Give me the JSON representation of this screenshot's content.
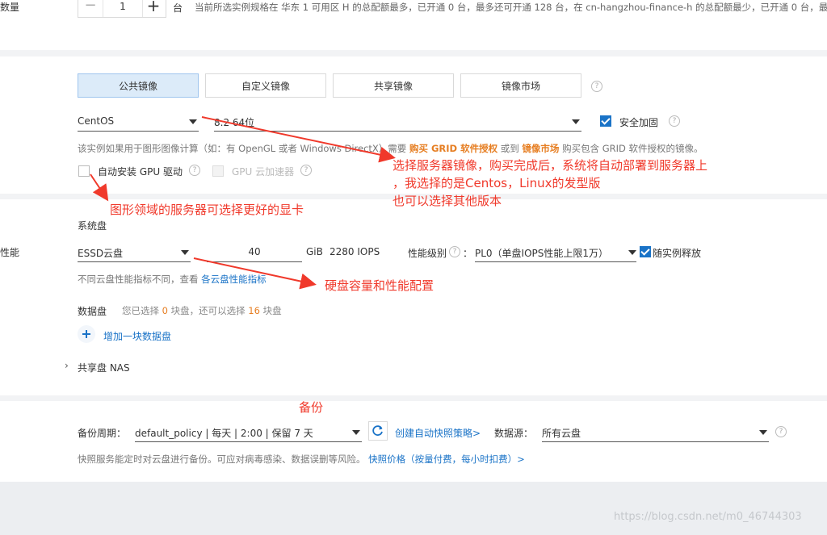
{
  "quantity": {
    "label": "数量",
    "value": "1",
    "unit": "台",
    "note": "当前所选实例规格在 华东 1 可用区 H 的总配额最多，已开通 0 台，最多还可开通 128 台，在 cn-hangzhou-finance-h 的总配额最少，已开通 0 台，最多"
  },
  "image": {
    "tabs": [
      "公共镜像",
      "自定义镜像",
      "共享镜像",
      "镜像市场"
    ],
    "os": "CentOS",
    "version": "8.2 64位",
    "security_label": "安全加固",
    "notice_prefix": "该实例如果用于图形图像计算（如：有 OpenGL 或者 Windows DirectX）需要",
    "notice_link1": "购买 GRID 软件授权",
    "notice_mid": "或到",
    "notice_link2": "镜像市场",
    "notice_suffix": "购买包含 GRID 软件授权的镜像。",
    "gpu_driver_label": "自动安装 GPU 驱动",
    "gpu_accel_label": "GPU 云加速器"
  },
  "storage": {
    "left_label": "性能",
    "system_disk_label": "系统盘",
    "disk_type": "ESSD云盘",
    "size": "40",
    "unit": "GiB",
    "iops": "2280 IOPS",
    "perf_label": "性能级别",
    "colon": "：",
    "perf_value": "PL0（单盘IOPS性能上限1万）",
    "release_label": "随实例释放",
    "disk_note_prefix": "不同云盘性能指标不同，查看",
    "disk_note_link": "各云盘性能指标",
    "data_disk_label": "数据盘",
    "data_disk_note_a": "您已选择",
    "data_disk_count": "0",
    "data_disk_note_b": "块盘，还可以选择",
    "data_disk_remain": "16",
    "data_disk_note_c": "块盘",
    "add_disk": "增加一块数据盘",
    "nas_label": "共享盘 NAS"
  },
  "backup": {
    "cycle_label": "备份周期：",
    "policy": "default_policy | 每天 | 2:00 | 保留 7 天",
    "create_policy": "创建自动快照策略>",
    "source_label": "数据源：",
    "source_value": "所有云盘",
    "note_prefix": "快照服务能定时对云盘进行备份。可应对病毒感染、数据误删等风险。",
    "note_link": "快照价格（按量付费，每小时扣费）>"
  },
  "annotations": {
    "image_line1": "选择服务器镜像，购买完成后，系统将自动部署到服务器上",
    "image_line2": "，我选择的是Centos，Linux的发型版",
    "image_line3": "也可以选择其他版本",
    "gpu": "图形领域的服务器可选择更好的显卡",
    "disk": "硬盘容量和性能配置",
    "backup": "备份"
  },
  "watermark": "https://blog.csdn.net/m0_46744303"
}
